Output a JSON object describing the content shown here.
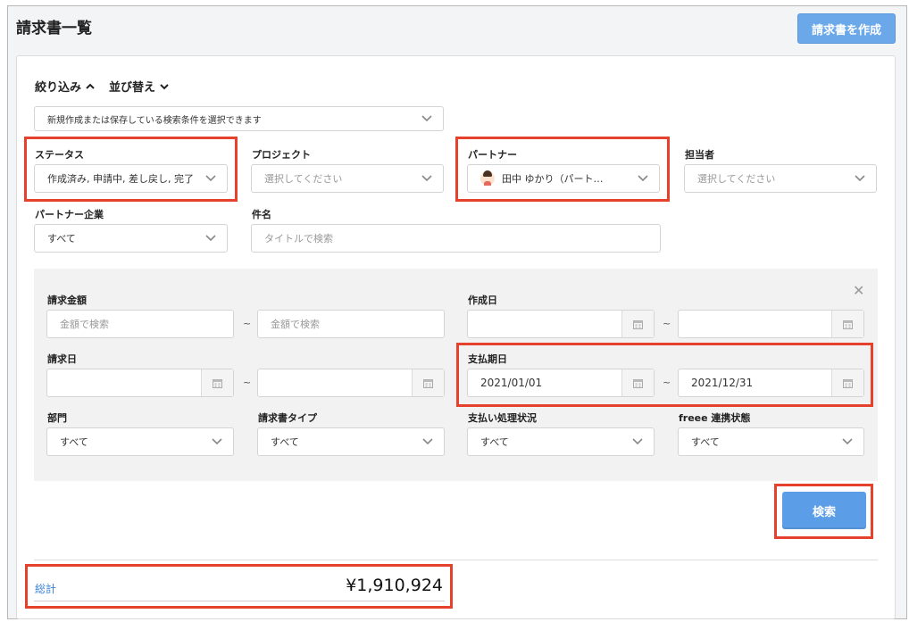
{
  "header": {
    "title": "請求書一覧",
    "create_button": "請求書を作成"
  },
  "filters": {
    "narrow_toggle": "絞り込み",
    "sort_toggle": "並び替え",
    "saved_conditions_placeholder": "新規作成または保存している検索条件を選択できます",
    "status": {
      "label": "ステータス",
      "value": "作成済み, 申請中, 差し戻し, 完了"
    },
    "project": {
      "label": "プロジェクト",
      "placeholder": "選択してください"
    },
    "partner": {
      "label": "パートナー",
      "value": "田中 ゆかり（パート…"
    },
    "assignee": {
      "label": "担当者",
      "placeholder": "選択してください"
    },
    "partner_company": {
      "label": "パートナー企業",
      "value": "すべて"
    },
    "subject": {
      "label": "件名",
      "placeholder": "タイトルで検索"
    }
  },
  "advanced": {
    "amount": {
      "label": "請求金額",
      "from_placeholder": "金額で検索",
      "to_placeholder": "金額で検索"
    },
    "created_date": {
      "label": "作成日",
      "from": "",
      "to": ""
    },
    "invoice_date": {
      "label": "請求日",
      "from": "",
      "to": ""
    },
    "due_date": {
      "label": "支払期日",
      "from": "2021/01/01",
      "to": "2021/12/31"
    },
    "department": {
      "label": "部門",
      "value": "すべて"
    },
    "invoice_type": {
      "label": "請求書タイプ",
      "value": "すべて"
    },
    "payment_status": {
      "label": "支払い処理状況",
      "value": "すべて"
    },
    "freee_status": {
      "label": "freee 連携状態",
      "value": "すべて"
    },
    "tilde": "~"
  },
  "search_button": "検索",
  "total": {
    "label": "総計",
    "value": "¥1,910,924"
  },
  "colors": {
    "accent": "#5b9de6",
    "highlight": "#e5412d",
    "link": "#3b82d6"
  }
}
